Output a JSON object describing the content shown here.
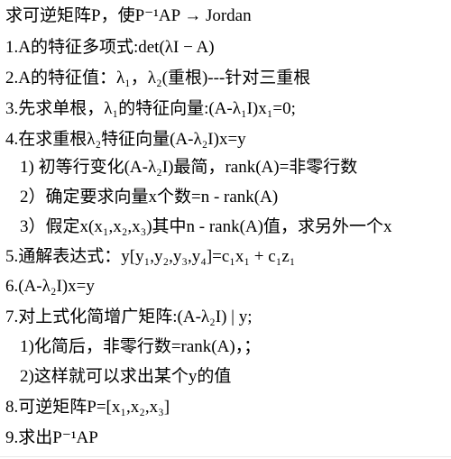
{
  "lines": [
    "求可逆矩阵P，使P⁻¹AP → Jordan",
    "1.A的特征多项式:det(λI − A)",
    "2.A的特征值：λ₁，λ₂(重根)---针对三重根",
    "3.先求单根，λ₁的特征向量:(A-λ₁I)x₁=0;",
    "4.在求重根λ₂特征向量(A-λ₂I)x=y",
    "1) 初等行变化(A-λ₂I)最简，rank(A)=非零行数",
    "2）确定要求向量x个数=n - rank(A)",
    "3）假定x(x₁,x₂,x₃)其中n - rank(A)值，求另外一个x",
    "5.通解表达式：y[y₁,y₂,y₃,y₄]=c₁x₁ + c₁z₁",
    "6.(A-λ₂I)x=y",
    "7.对上式化简增广矩阵:(A-λ₂I) | y;",
    "1)化简后，非零行数=rank(A)，；",
    "2)这样就可以求出某个y的值",
    "8.可逆矩阵P=[x₁,x₂,x₃]",
    "9.求出P⁻¹AP"
  ]
}
